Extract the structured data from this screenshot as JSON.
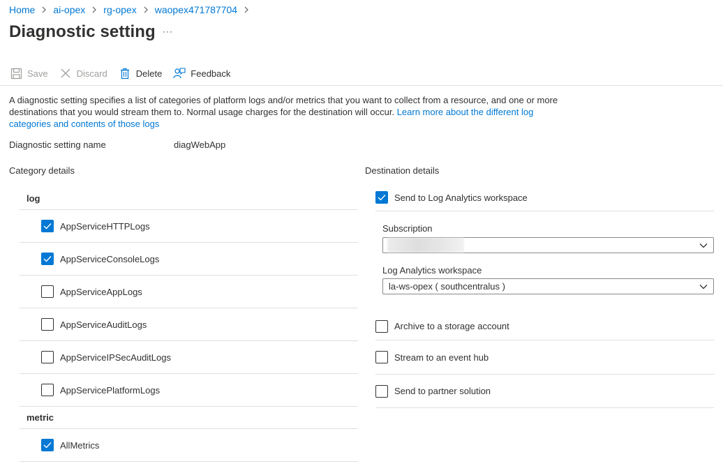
{
  "breadcrumb": [
    {
      "label": "Home"
    },
    {
      "label": "ai-opex"
    },
    {
      "label": "rg-opex"
    },
    {
      "label": "waopex471787704"
    }
  ],
  "page": {
    "title": "Diagnostic setting",
    "more": "···"
  },
  "toolbar": {
    "save": "Save",
    "discard": "Discard",
    "delete": "Delete",
    "feedback": "Feedback"
  },
  "description": {
    "text": "A diagnostic setting specifies a list of categories of platform logs and/or metrics that you want to collect from a resource, and one or more destinations that you would stream them to. Normal usage charges for the destination will occur. ",
    "link": "Learn more about the different log categories and contents of those logs"
  },
  "setting_name": {
    "label": "Diagnostic setting name",
    "value": "diagWebApp"
  },
  "category_details": {
    "label": "Category details",
    "groups": [
      {
        "name": "log",
        "items": [
          {
            "label": "AppServiceHTTPLogs",
            "checked": true
          },
          {
            "label": "AppServiceConsoleLogs",
            "checked": true
          },
          {
            "label": "AppServiceAppLogs",
            "checked": false
          },
          {
            "label": "AppServiceAuditLogs",
            "checked": false
          },
          {
            "label": "AppServiceIPSecAuditLogs",
            "checked": false
          },
          {
            "label": "AppServicePlatformLogs",
            "checked": false
          }
        ]
      },
      {
        "name": "metric",
        "items": [
          {
            "label": "AllMetrics",
            "checked": true
          }
        ]
      }
    ]
  },
  "destination_details": {
    "label": "Destination details",
    "log_analytics": {
      "label": "Send to Log Analytics workspace",
      "checked": true
    },
    "subscription": {
      "label": "Subscription",
      "value": ""
    },
    "workspace": {
      "label": "Log Analytics workspace",
      "value": "la-ws-opex ( southcentralus )"
    },
    "storage": {
      "label": "Archive to a storage account",
      "checked": false
    },
    "event_hub": {
      "label": "Stream to an event hub",
      "checked": false
    },
    "partner": {
      "label": "Send to partner solution",
      "checked": false
    }
  },
  "colors": {
    "accent": "#0078d4",
    "text": "#323130",
    "disabled": "#a19f9d",
    "divider": "#e1dfdd"
  }
}
